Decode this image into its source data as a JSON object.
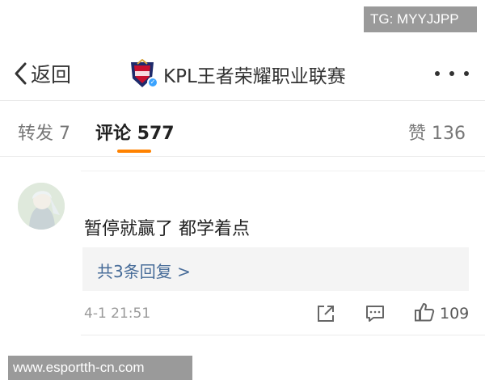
{
  "watermarks": {
    "top": "TG: MYYJJPP",
    "bottom": "www.esportth-cn.com"
  },
  "navbar": {
    "back_label": "返回",
    "title": "KPL王者荣耀职业联赛",
    "logo_icon": "kpl-logo",
    "more_icon": "more-dots-icon"
  },
  "tabs": {
    "repost": "转发 7",
    "comments": "评论 577",
    "likes": "赞 136",
    "active": "comments",
    "accent_color": "#ff8200"
  },
  "comment": {
    "text": "暂停就赢了 都学着点",
    "replies_label": "共3条回复 >",
    "timestamp": "4-1 21:51",
    "like_count": "109",
    "link_color": "#466b98"
  }
}
